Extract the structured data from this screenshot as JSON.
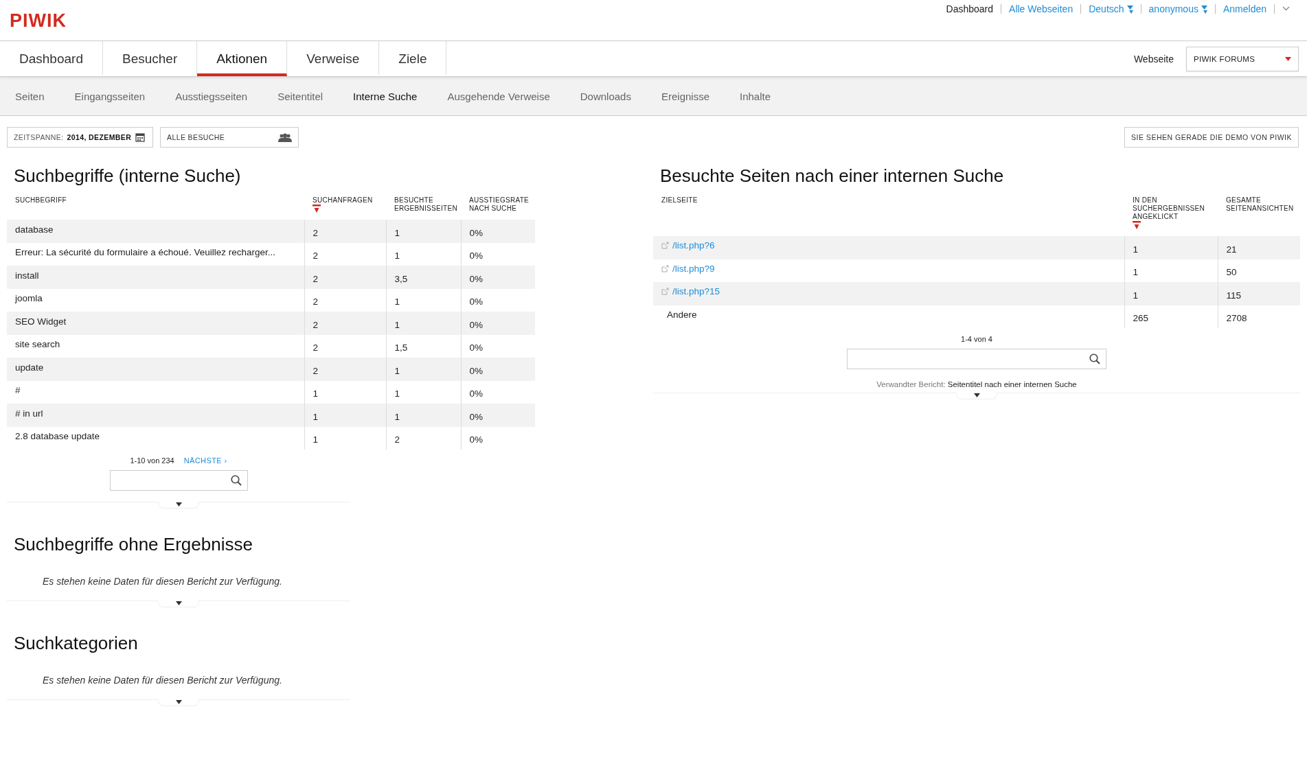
{
  "logo": "PIWIK",
  "top_links": [
    {
      "label": "Dashboard",
      "kind": "plain"
    },
    {
      "label": "Alle Webseiten",
      "kind": "link"
    },
    {
      "label": "Deutsch",
      "kind": "dropdown"
    },
    {
      "label": "anonymous",
      "kind": "dropdown"
    },
    {
      "label": "Anmelden",
      "kind": "link"
    }
  ],
  "main_tabs": [
    {
      "label": "Dashboard",
      "selected": false
    },
    {
      "label": "Besucher",
      "selected": false
    },
    {
      "label": "Aktionen",
      "selected": true
    },
    {
      "label": "Verweise",
      "selected": false
    },
    {
      "label": "Ziele",
      "selected": false
    }
  ],
  "website_selector": {
    "label": "Webseite",
    "value": "PIWIK FORUMS"
  },
  "sub_tabs": [
    {
      "label": "Seiten",
      "selected": false
    },
    {
      "label": "Eingangsseiten",
      "selected": false
    },
    {
      "label": "Ausstiegsseiten",
      "selected": false
    },
    {
      "label": "Seitentitel",
      "selected": false
    },
    {
      "label": "Interne Suche",
      "selected": true
    },
    {
      "label": "Ausgehende Verweise",
      "selected": false
    },
    {
      "label": "Downloads",
      "selected": false
    },
    {
      "label": "Ereignisse",
      "selected": false
    },
    {
      "label": "Inhalte",
      "selected": false
    }
  ],
  "period_selector": {
    "label": "ZEITSPANNE:",
    "value": "2014, DEZEMBER"
  },
  "segment_selector": {
    "value": "ALLE BESUCHE"
  },
  "demo_notice": "SIE SEHEN GERADE DIE DEMO VON PIWIK",
  "left_column": [
    {
      "kind": "table",
      "title": "Suchbegriffe (interne Suche)",
      "columns": [
        {
          "label": "SUCHBEGRIFF",
          "sorted": false
        },
        {
          "label": "SUCHANFRAGEN",
          "sorted": true
        },
        {
          "label": "BESUCHTE ERGEBNISSEITEN",
          "sorted": false
        },
        {
          "label": "AUSSTIEGSRATE NACH SUCHE",
          "sorted": false
        }
      ],
      "rows": [
        {
          "kind": "plain",
          "cells": [
            "database",
            "2",
            "1",
            "0%"
          ]
        },
        {
          "kind": "plain",
          "cells": [
            "Erreur: La sécurité du formulaire a échoué. Veuillez recharger...",
            "2",
            "1",
            "0%"
          ]
        },
        {
          "kind": "plain",
          "cells": [
            "install",
            "2",
            "3,5",
            "0%"
          ]
        },
        {
          "kind": "plain",
          "cells": [
            "joomla",
            "2",
            "1",
            "0%"
          ]
        },
        {
          "kind": "plain",
          "cells": [
            "SEO Widget",
            "2",
            "1",
            "0%"
          ]
        },
        {
          "kind": "plain",
          "cells": [
            "site search",
            "2",
            "1,5",
            "0%"
          ]
        },
        {
          "kind": "plain",
          "cells": [
            "update",
            "2",
            "1",
            "0%"
          ]
        },
        {
          "kind": "plain",
          "cells": [
            "#",
            "1",
            "1",
            "0%"
          ]
        },
        {
          "kind": "plain",
          "cells": [
            "# in url",
            "1",
            "1",
            "0%"
          ]
        },
        {
          "kind": "plain",
          "cells": [
            "2.8 database update",
            "1",
            "2",
            "0%"
          ]
        }
      ],
      "pagination": "1-10 von 234",
      "next_link": "NÄCHSTE ›"
    },
    {
      "kind": "empty",
      "title": "Suchbegriffe ohne Ergebnisse",
      "message": "Es stehen keine Daten für diesen Bericht zur Verfügung."
    },
    {
      "kind": "empty",
      "title": "Suchkategorien",
      "message": "Es stehen keine Daten für diesen Bericht zur Verfügung."
    }
  ],
  "right_column": [
    {
      "kind": "table",
      "title": "Besuchte Seiten nach einer internen Suche",
      "columns": [
        {
          "label": "ZIELSEITE",
          "sorted": false
        },
        {
          "label": "IN DEN SUCHERGEBNISSEN ANGEKLICKT",
          "sorted": true
        },
        {
          "label": "GESAMTE SEITENANSICHTEN",
          "sorted": false
        }
      ],
      "rows": [
        {
          "kind": "link",
          "cells": [
            "/list.php?6",
            "1",
            "21"
          ]
        },
        {
          "kind": "link",
          "cells": [
            "/list.php?9",
            "1",
            "50"
          ]
        },
        {
          "kind": "link",
          "cells": [
            "/list.php?15",
            "1",
            "115"
          ]
        },
        {
          "kind": "plain",
          "cells": [
            "Andere",
            "265",
            "2708"
          ]
        }
      ],
      "pagination": "1-4 von 4",
      "related": {
        "label": "Verwandter Bericht:",
        "link": "Seitentitel nach einer internen Suche"
      }
    }
  ]
}
